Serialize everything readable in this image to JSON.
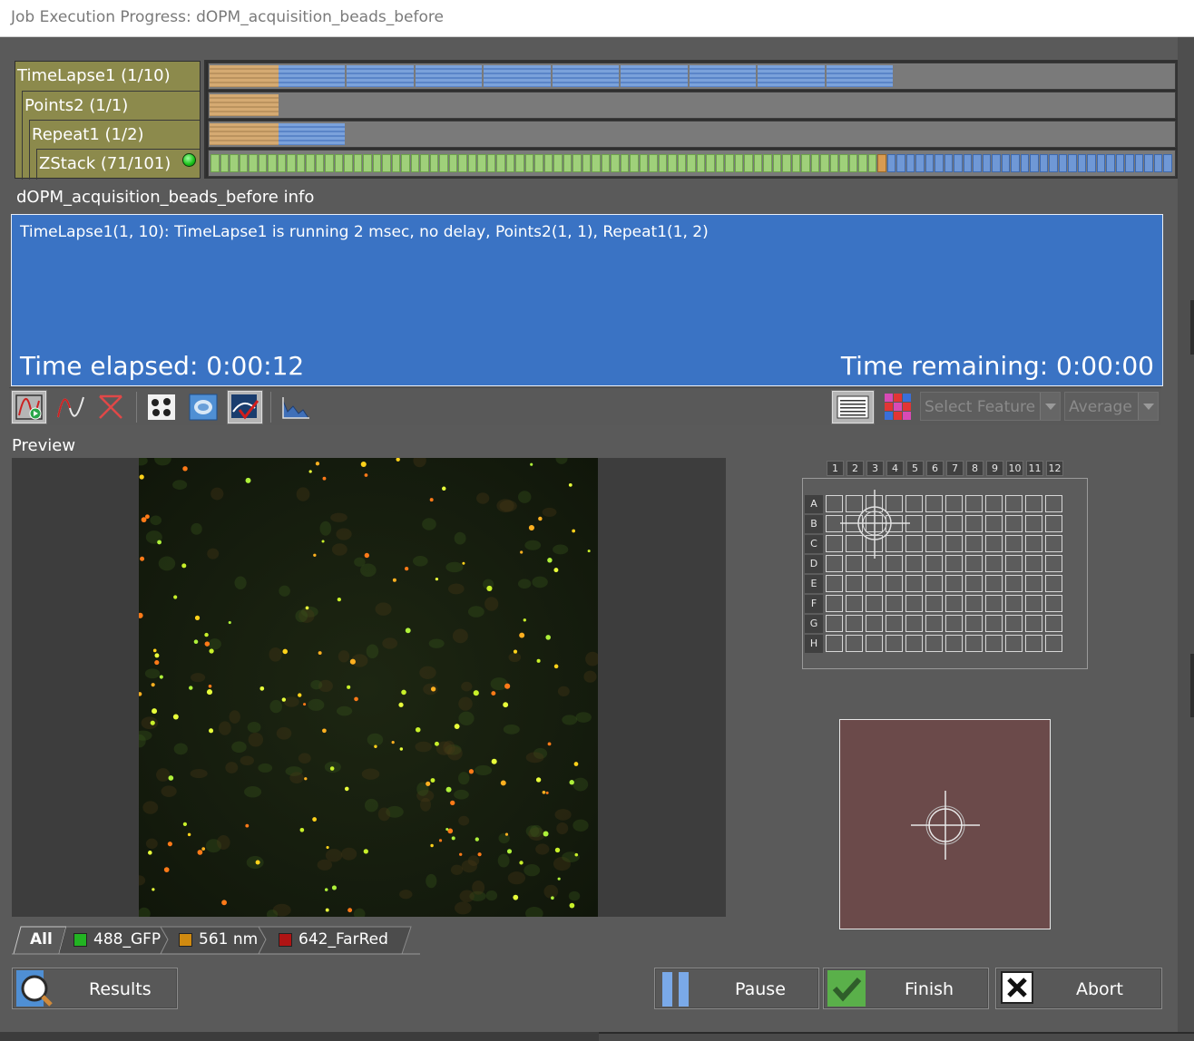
{
  "window": {
    "title": "Job Execution Progress: dOPM_acquisition_beads_before"
  },
  "tree": [
    {
      "label": "TimeLapse1 (1/10)",
      "done": 1,
      "total": 10
    },
    {
      "label": "Points2 (1/1)",
      "done": 1,
      "total": 1
    },
    {
      "label": "Repeat1 (1/2)",
      "done": 1,
      "total": 2
    },
    {
      "label": "ZStack (71/101)",
      "done": 71,
      "total": 101
    }
  ],
  "info": {
    "title": "dOPM_acquisition_beads_before info",
    "text": "TimeLapse1(1, 10): TimeLapse1 is running 2 msec, no delay, Points2(1, 1), Repeat1(1, 2)",
    "elapsed": "Time elapsed: 0:00:12",
    "remaining": "Time remaining: 0:00:00"
  },
  "toolbar": {
    "feature_select": "Select Feature",
    "average_select": "Average",
    "icons": [
      "live-graph-icon",
      "curve-icon",
      "cross-curve-icon",
      "dots-icon",
      "blob-icon",
      "checked-image-icon",
      "histogram-icon",
      "well-plate-icon",
      "color-grid-icon"
    ]
  },
  "preview": {
    "label": "Preview"
  },
  "plate": {
    "columns": [
      "1",
      "2",
      "3",
      "4",
      "5",
      "6",
      "7",
      "8",
      "9",
      "10",
      "11",
      "12"
    ],
    "rows": [
      "A",
      "B",
      "C",
      "D",
      "E",
      "F",
      "G",
      "H"
    ]
  },
  "channels": [
    {
      "label": "All",
      "color": ""
    },
    {
      "label": "488_GFP",
      "color": "#22b422"
    },
    {
      "label": "561 nm",
      "color": "#d08a10"
    },
    {
      "label": "642_FarRed",
      "color": "#b01414"
    }
  ],
  "buttons": {
    "results": "Results",
    "pause": "Pause",
    "finish": "Finish",
    "abort": "Abort"
  },
  "colors": {
    "info_bg": "#3a73c4",
    "tree_bg": "#8c8a4c",
    "done": "#9fd07a",
    "pending": "#6f98d6",
    "current": "#d89b52"
  }
}
